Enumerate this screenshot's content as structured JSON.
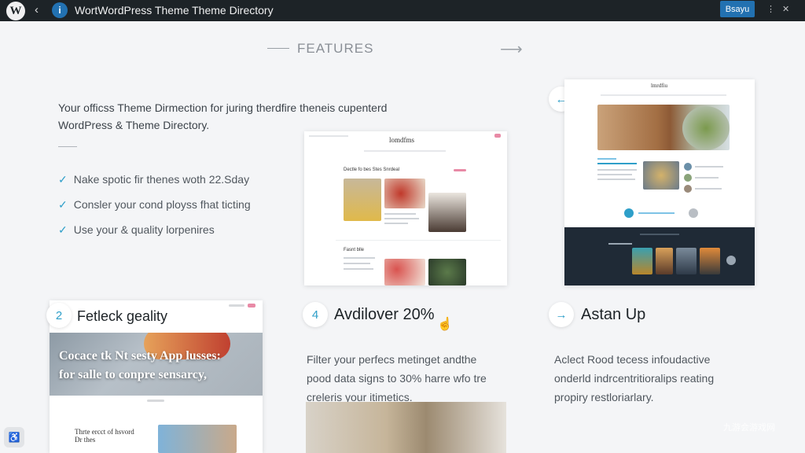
{
  "topbar": {
    "title": "WortWordPress Theme Theme Directory",
    "button_label": "Bsayu",
    "icons": [
      "wordpress-logo",
      "chevron-left-icon",
      "info-icon",
      "more-vertical-icon",
      "close-icon"
    ]
  },
  "features": {
    "heading": "FEATURES",
    "intro_line1": "Your officss Theme Dirmection for juring therdfire theneis cupenterd",
    "intro_line2": "WordPress & Theme Directory.",
    "checks": [
      "Nake spotic fir thenes woth 22.Sday",
      "Consler your cond ployss fhat ticting",
      "Use your & quality lorpenires"
    ]
  },
  "mocks": {
    "center_brand": "lomdfms",
    "center_heading": "Dectle fo bes Stes Snrdeal",
    "center_sub": "Fasnt blle",
    "right_brand": "lmrdfiu"
  },
  "columns": [
    {
      "number": "2",
      "title": "Fetleck geality",
      "hero_line1": "Cocace tk Nt sesty App lusses:",
      "hero_line2": "for salle to conpre sensarcy,",
      "card_text1": "Thrte ercct of hsvord",
      "card_text2": "Dr thes"
    },
    {
      "number": "4",
      "title": "Avdilover 20%",
      "desc_line1": "Filter your perfecs metinget andthe",
      "desc_line2": "pood data signs to 30% harre wfo tre",
      "desc_line3": "creleris your itimetics."
    },
    {
      "number": "→",
      "title": "Astan Up",
      "desc_line1": "Aclect Rood tecess infoudactive",
      "desc_line2": "onderld indrcentritioralips reating",
      "desc_line3": "propiry restloriarlary."
    }
  ],
  "watermark": "九游会游戏网",
  "colors": {
    "topbar": "#1d2327",
    "accent": "#2e9fc9",
    "button": "#2271b1"
  }
}
